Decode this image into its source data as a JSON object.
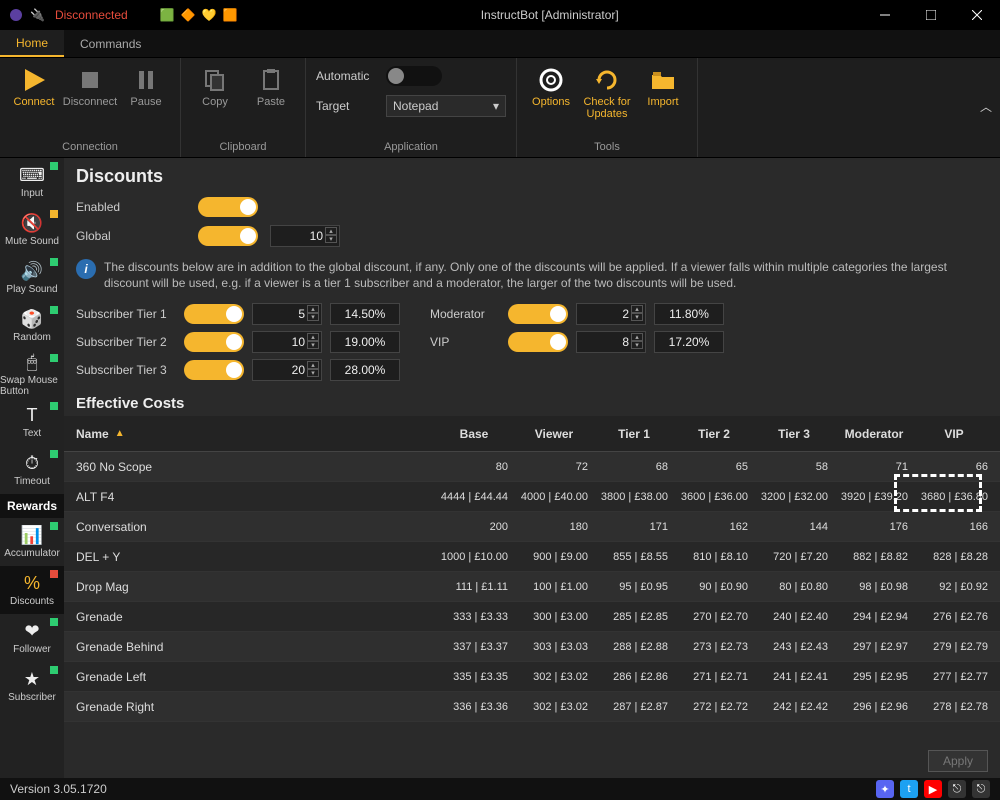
{
  "window": {
    "title": "InstructBot [Administrator]",
    "status": "Disconnected"
  },
  "tabs": {
    "home": "Home",
    "commands": "Commands"
  },
  "ribbon": {
    "connection": {
      "label": "Connection",
      "connect": "Connect",
      "disconnect": "Disconnect",
      "pause": "Pause"
    },
    "clipboard": {
      "label": "Clipboard",
      "copy": "Copy",
      "paste": "Paste"
    },
    "application": {
      "label": "Application",
      "automatic": "Automatic",
      "target": "Target",
      "target_value": "Notepad"
    },
    "tools": {
      "label": "Tools",
      "options": "Options",
      "updates": "Check for Updates",
      "import": "Import"
    }
  },
  "sidenav": [
    {
      "label": "Input",
      "active": false
    },
    {
      "label": "Mute Sound",
      "active": false
    },
    {
      "label": "Play Sound",
      "active": false
    },
    {
      "label": "Random",
      "active": false
    },
    {
      "label": "Swap Mouse Button",
      "active": false
    },
    {
      "label": "Text",
      "active": false
    },
    {
      "label": "Timeout",
      "active": false
    },
    {
      "label": "Rewards",
      "section": true
    },
    {
      "label": "Accumulator",
      "active": false
    },
    {
      "label": "Discounts",
      "active": true
    },
    {
      "label": "Follower",
      "active": false
    },
    {
      "label": "Subscriber",
      "active": false
    }
  ],
  "discounts": {
    "title": "Discounts",
    "enabled_label": "Enabled",
    "global_label": "Global",
    "global_value": "10",
    "info": "The discounts below are in addition to the global discount, if any. Only one of the discounts will be applied. If a viewer falls within multiple categories the largest discount will be used, e.g. if a viewer is a tier 1 subscriber and a moderator, the larger of the two discounts will be used.",
    "tiers": {
      "t1": {
        "label": "Subscriber Tier 1",
        "value": "5",
        "pct": "14.50%"
      },
      "t2": {
        "label": "Subscriber Tier 2",
        "value": "10",
        "pct": "19.00%"
      },
      "t3": {
        "label": "Subscriber Tier 3",
        "value": "20",
        "pct": "28.00%"
      },
      "mod": {
        "label": "Moderator",
        "value": "2",
        "pct": "11.80%"
      },
      "vip": {
        "label": "VIP",
        "value": "8",
        "pct": "17.20%"
      }
    }
  },
  "table": {
    "title": "Effective Costs",
    "headers": {
      "name": "Name",
      "base": "Base",
      "viewer": "Viewer",
      "t1": "Tier 1",
      "t2": "Tier 2",
      "t3": "Tier 3",
      "mod": "Moderator",
      "vip": "VIP"
    },
    "rows": [
      {
        "name": "360 No Scope",
        "base": "80",
        "viewer": "72",
        "t1": "68",
        "t2": "65",
        "t3": "58",
        "mod": "71",
        "vip": "66"
      },
      {
        "name": "ALT F4",
        "base": "4444 | £44.44",
        "viewer": "4000 | £40.00",
        "t1": "3800 | £38.00",
        "t2": "3600 | £36.00",
        "t3": "3200 | £32.00",
        "mod": "3920 | £39.20",
        "vip": "3680 | £36.80"
      },
      {
        "name": "Conversation",
        "base": "200",
        "viewer": "180",
        "t1": "171",
        "t2": "162",
        "t3": "144",
        "mod": "176",
        "vip": "166"
      },
      {
        "name": "DEL + Y",
        "base": "1000 | £10.00",
        "viewer": "900 | £9.00",
        "t1": "855 | £8.55",
        "t2": "810 | £8.10",
        "t3": "720 | £7.20",
        "mod": "882 | £8.82",
        "vip": "828 | £8.28"
      },
      {
        "name": "Drop Mag",
        "base": "111 | £1.11",
        "viewer": "100 | £1.00",
        "t1": "95 | £0.95",
        "t2": "90 | £0.90",
        "t3": "80 | £0.80",
        "mod": "98 | £0.98",
        "vip": "92 | £0.92"
      },
      {
        "name": "Grenade",
        "base": "333 | £3.33",
        "viewer": "300 | £3.00",
        "t1": "285 | £2.85",
        "t2": "270 | £2.70",
        "t3": "240 | £2.40",
        "mod": "294 | £2.94",
        "vip": "276 | £2.76"
      },
      {
        "name": "Grenade Behind",
        "base": "337 | £3.37",
        "viewer": "303 | £3.03",
        "t1": "288 | £2.88",
        "t2": "273 | £2.73",
        "t3": "243 | £2.43",
        "mod": "297 | £2.97",
        "vip": "279 | £2.79"
      },
      {
        "name": "Grenade Left",
        "base": "335 | £3.35",
        "viewer": "302 | £3.02",
        "t1": "286 | £2.86",
        "t2": "271 | £2.71",
        "t3": "241 | £2.41",
        "mod": "295 | £2.95",
        "vip": "277 | £2.77"
      },
      {
        "name": "Grenade Right",
        "base": "336 | £3.36",
        "viewer": "302 | £3.02",
        "t1": "287 | £2.87",
        "t2": "272 | £2.72",
        "t3": "242 | £2.42",
        "mod": "296 | £2.96",
        "vip": "278 | £2.78"
      }
    ]
  },
  "footer": {
    "apply": "Apply",
    "version": "Version 3.05.1720"
  }
}
